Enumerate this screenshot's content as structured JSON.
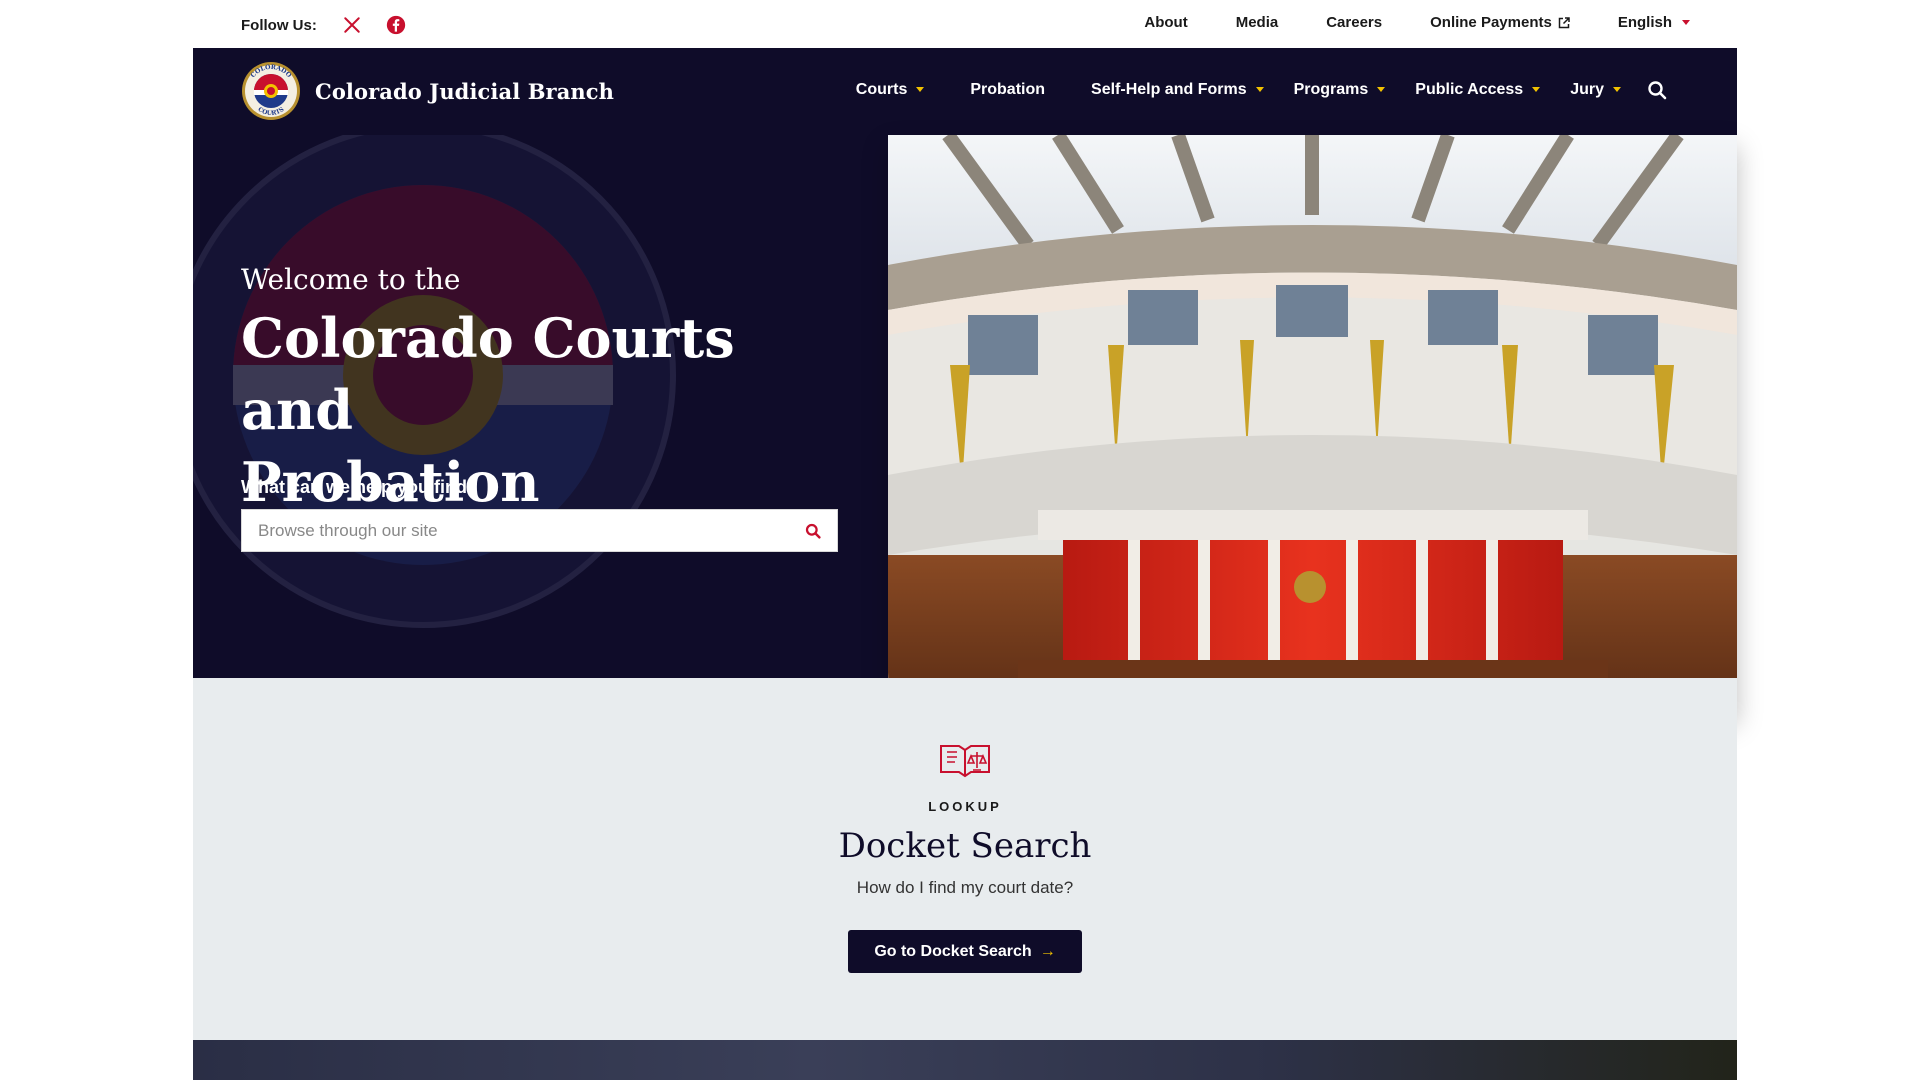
{
  "utility": {
    "follow_label": "Follow Us:",
    "social": [
      {
        "icon": "x-icon"
      },
      {
        "icon": "facebook-icon"
      }
    ],
    "links": [
      {
        "label": "About"
      },
      {
        "label": "Media"
      },
      {
        "label": "Careers"
      },
      {
        "label": "Online Payments",
        "icon": "external-link-icon"
      },
      {
        "label": "English",
        "icon": "chevron-down-icon"
      }
    ]
  },
  "nav": {
    "brand": "Colorado Judicial Branch",
    "logo_text_top": "COLORADO",
    "logo_text_bottom": "COURTS",
    "items": [
      {
        "label": "Courts",
        "dropdown": true
      },
      {
        "label": "Probation",
        "dropdown": false
      },
      {
        "label": "Self-Help and Forms",
        "dropdown": true
      },
      {
        "label": "Programs",
        "dropdown": true
      },
      {
        "label": "Public Access",
        "dropdown": true
      },
      {
        "label": "Jury",
        "dropdown": true
      }
    ]
  },
  "hero": {
    "pre_title": "Welcome to the",
    "title_line1": "Colorado Courts and",
    "title_line2": "Probation",
    "help_label": "What can we help you find?",
    "search_placeholder": "Browse through our site"
  },
  "lookup": {
    "eyebrow": "LOOKUP",
    "title": "Docket Search",
    "subtitle": "How do I find my court date?",
    "button": "Go to Docket Search",
    "button_arrow": "→"
  },
  "colors": {
    "navy": "#0f0c29",
    "gold": "#f2c200",
    "red": "#c8102e",
    "section_bg": "#e8ecee"
  }
}
